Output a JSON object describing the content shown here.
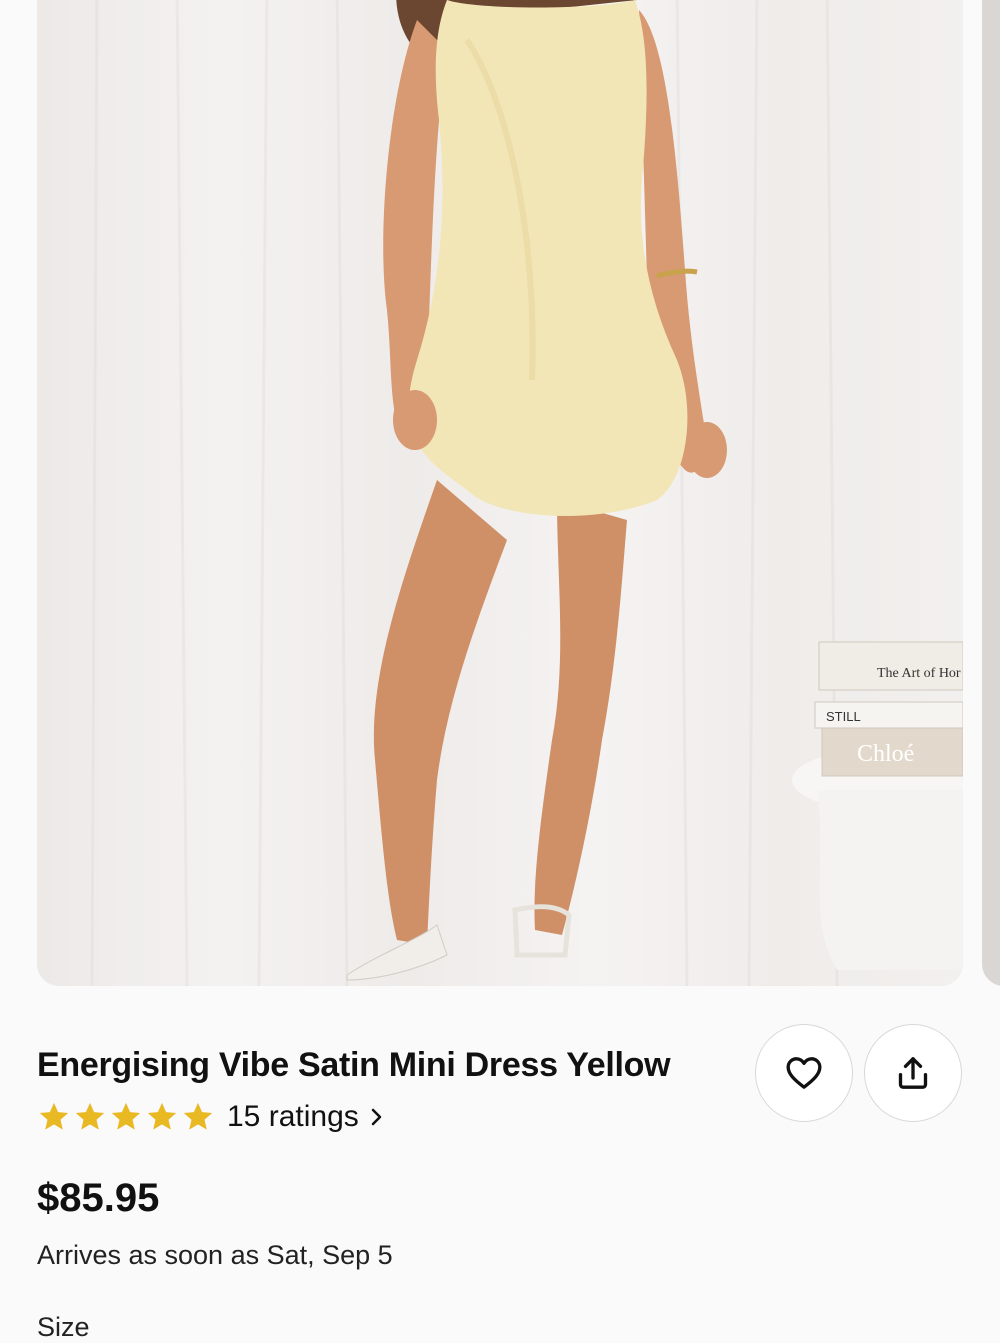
{
  "product": {
    "title": "Energising Vibe Satin Mini Dress Yellow",
    "rating_stars": 5,
    "rating_max": 5,
    "ratings_count_label": "15 ratings",
    "price": "$85.95",
    "delivery": "Arrives as soon as Sat, Sep 5",
    "size_label": "Size"
  },
  "photo_book_texts": {
    "book1": "The Art of Hor",
    "book2": "STILL",
    "book3": "Chloé"
  },
  "icons": {
    "favorite": "heart-icon",
    "share": "share-icon",
    "star": "star-icon",
    "chevron": "chevron-right-icon"
  },
  "colors": {
    "star": "#E8B923",
    "dress": "#F3E6B6",
    "text": "#111111"
  }
}
